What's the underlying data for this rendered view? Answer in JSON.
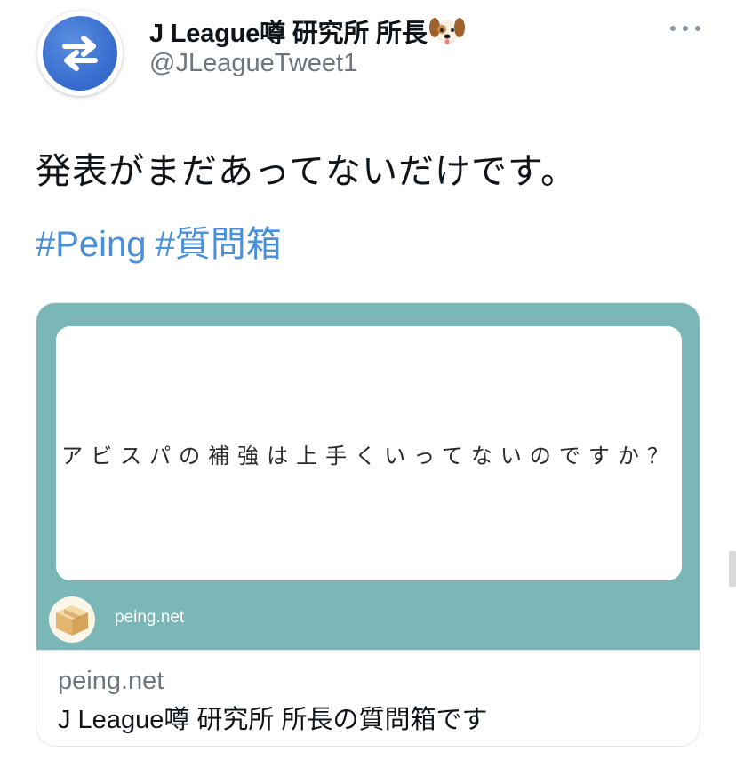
{
  "tweet": {
    "display_name": "J League噂 研究所 所長",
    "handle": "@JLeagueTweet1",
    "text": "発表がまだあってないだけです。",
    "hashtags": [
      "#Peing",
      "#質問箱"
    ],
    "avatar_icon": "swap-arrows-icon",
    "name_emoji_icon": "dog-face-icon",
    "more_icon": "more-horizontal-icon"
  },
  "card": {
    "question": "アビスパの補強は上手くいってないのですか？",
    "brand": "peing.net",
    "domain": "peing.net",
    "title": "J League噂 研究所 所長の質問箱です",
    "image_background": "#7ab7b6",
    "brand_icon": "cardboard-box-icon"
  },
  "colors": {
    "hashtag": "#4a90d9",
    "secondary_text": "#6e767d",
    "avatar": "#3a6fcf"
  }
}
